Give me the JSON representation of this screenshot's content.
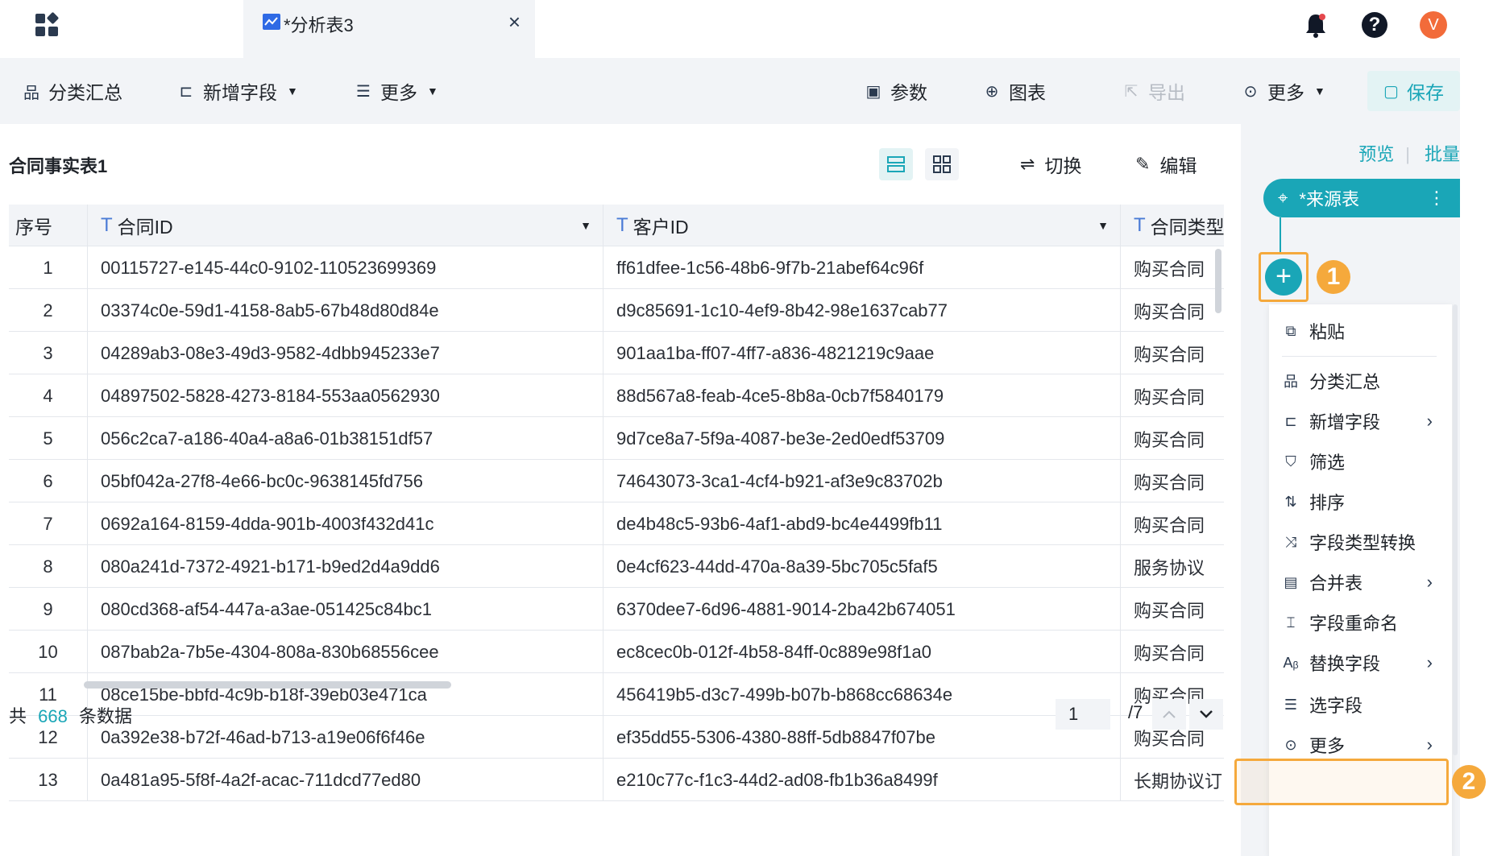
{
  "tab": {
    "title": "*分析表3",
    "close": "×"
  },
  "topbar": {
    "avatar_letter": "V",
    "help_glyph": "?"
  },
  "toolbar": {
    "group_summary": "分类汇总",
    "add_field": "新增字段",
    "more_left": "更多",
    "params": "参数",
    "chart": "图表",
    "export": "导出",
    "more_right": "更多",
    "save": "保存"
  },
  "main": {
    "table_title": "合同事实表1",
    "switch": "切换",
    "edit": "编辑",
    "columns": [
      "序号",
      "合同ID",
      "客户ID",
      "合同类型"
    ],
    "rows": [
      [
        "1",
        "00115727-e145-44c0-9102-110523699369",
        "ff61dfee-1c56-48b6-9f7b-21abef64c96f",
        "购买合同"
      ],
      [
        "2",
        "03374c0e-59d1-4158-8ab5-67b48d80d84e",
        "d9c85691-1c10-4ef9-8b42-98e1637cab77",
        "购买合同"
      ],
      [
        "3",
        "04289ab3-08e3-49d3-9582-4dbb945233e7",
        "901aa1ba-ff07-4ff7-a836-4821219c9aae",
        "购买合同"
      ],
      [
        "4",
        "04897502-5828-4273-8184-553aa0562930",
        "88d567a8-feab-4ce5-8b8a-0cb7f5840179",
        "购买合同"
      ],
      [
        "5",
        "056c2ca7-a186-40a4-a8a6-01b38151df57",
        "9d7ce8a7-5f9a-4087-be3e-2ed0edf53709",
        "购买合同"
      ],
      [
        "6",
        "05bf042a-27f8-4e66-bc0c-9638145fd756",
        "74643073-3ca1-4cf4-b921-af3e9c83702b",
        "购买合同"
      ],
      [
        "7",
        "0692a164-8159-4dda-901b-4003f432d41c",
        "de4b48c5-93b6-4af1-abd9-bc4e4499fb11",
        "购买合同"
      ],
      [
        "8",
        "080a241d-7372-4921-b171-b9ed2d4a9dd6",
        "0e4cf623-44dd-470a-8a39-5bc705c5faf5",
        "服务协议"
      ],
      [
        "9",
        "080cd368-af54-447a-a3ae-051425c84bc1",
        "6370dee7-6d96-4881-9014-2ba42b674051",
        "购买合同"
      ],
      [
        "10",
        "087bab2a-7b5e-4304-808a-830b68556cee",
        "ec8cec0b-012f-4b58-84ff-0c889e98f1a0",
        "购买合同"
      ],
      [
        "11",
        "08ce15be-bbfd-4c9b-b18f-39eb03e471ca",
        "456419b5-d3c7-499b-b07b-b868cc68634e",
        "购买合同"
      ],
      [
        "12",
        "0a392e38-b72f-46ad-b713-a19e06f6f46e",
        "ef35dd55-5306-4380-88ff-5db8847f07be",
        "购买合同"
      ],
      [
        "13",
        "0a481a95-5f8f-4a2f-acac-711dcd77ed80",
        "e210c77c-f1c3-44d2-ad08-fb1b36a8499f",
        "长期协议订"
      ]
    ],
    "footer": {
      "prefix": "共",
      "count": "668",
      "suffix": "条数据",
      "page": "1",
      "total_pages": "/7"
    }
  },
  "flow": {
    "preview": "预览",
    "batch": "批量",
    "source_node": "*来源表",
    "badge_1": "1",
    "badge_2": "2",
    "menu": [
      {
        "label": "粘贴",
        "icon": "paste-icon"
      },
      {
        "label": "分类汇总",
        "icon": "group-icon"
      },
      {
        "label": "新增字段",
        "icon": "add-field-icon",
        "submenu": true
      },
      {
        "label": "筛选",
        "icon": "filter-icon"
      },
      {
        "label": "排序",
        "icon": "sort-icon"
      },
      {
        "label": "字段类型转换",
        "icon": "convert-icon"
      },
      {
        "label": "合并表",
        "icon": "merge-icon",
        "submenu": true
      },
      {
        "label": "字段重命名",
        "icon": "rename-icon"
      },
      {
        "label": "替换字段",
        "icon": "replace-icon",
        "submenu": true
      },
      {
        "label": "选字段",
        "icon": "select-field-icon"
      },
      {
        "label": "更多",
        "icon": "more-icon",
        "submenu": true
      }
    ]
  },
  "colors": {
    "accent": "#1aa6b7",
    "highlight": "#f5a93c",
    "toolbar_bg": "#f2f4f7"
  }
}
